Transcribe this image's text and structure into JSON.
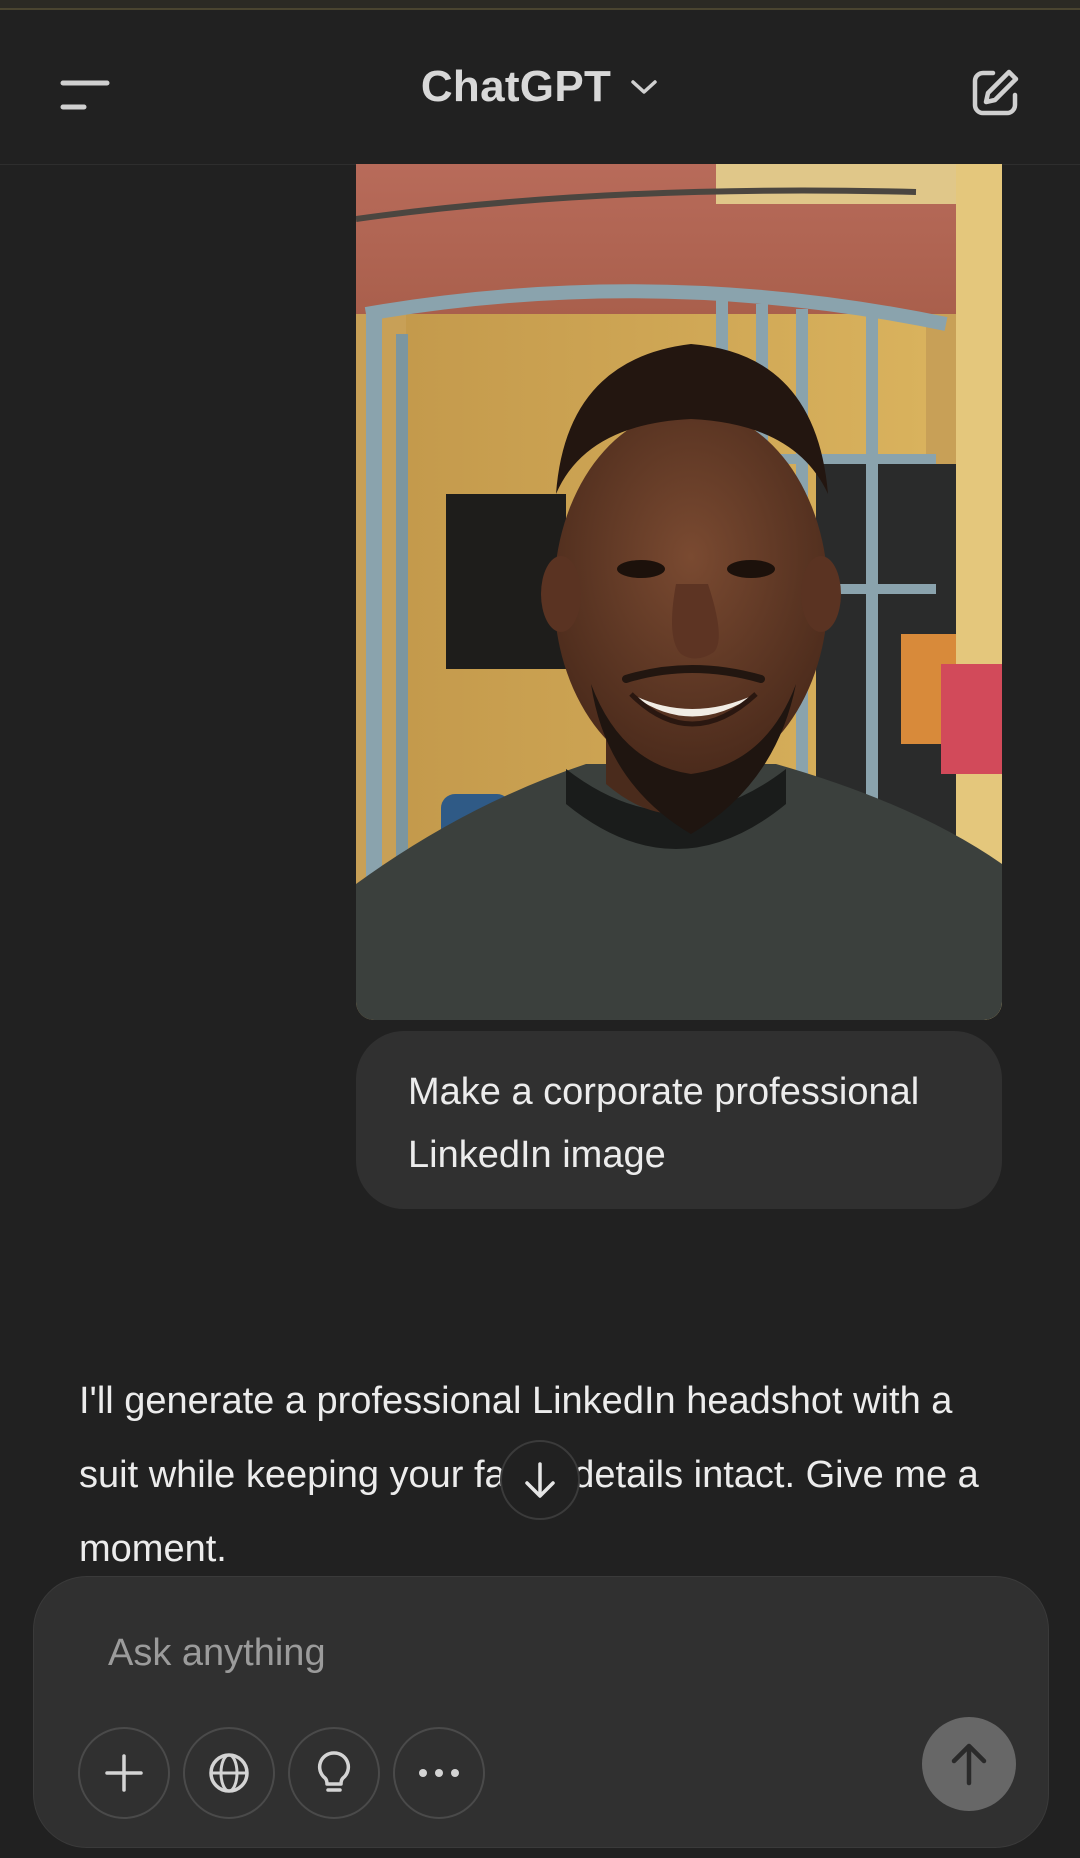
{
  "header": {
    "title": "ChatGPT",
    "menu_icon": "sidebar-menu-icon",
    "dropdown_icon": "chevron-down-icon",
    "new_chat_icon": "compose-icon"
  },
  "conversation": {
    "user_image": {
      "subject": "selfie-photo"
    },
    "user_message": "Make a corporate professional LinkedIn image",
    "assistant_message": "I'll generate a professional LinkedIn headshot with a suit while keeping your facial details intact. Give me a moment."
  },
  "composer": {
    "placeholder": "Ask anything",
    "tools": [
      {
        "name": "add",
        "icon": "plus-icon"
      },
      {
        "name": "search",
        "icon": "globe-icon"
      },
      {
        "name": "reason",
        "icon": "lightbulb-icon"
      },
      {
        "name": "more",
        "icon": "ellipsis-icon"
      }
    ],
    "send_icon": "arrow-up-icon"
  },
  "colors": {
    "background": "#212121",
    "bubble": "#303030",
    "text": "#ececec",
    "placeholder": "#9b9b9b",
    "send_button": "#676767"
  }
}
